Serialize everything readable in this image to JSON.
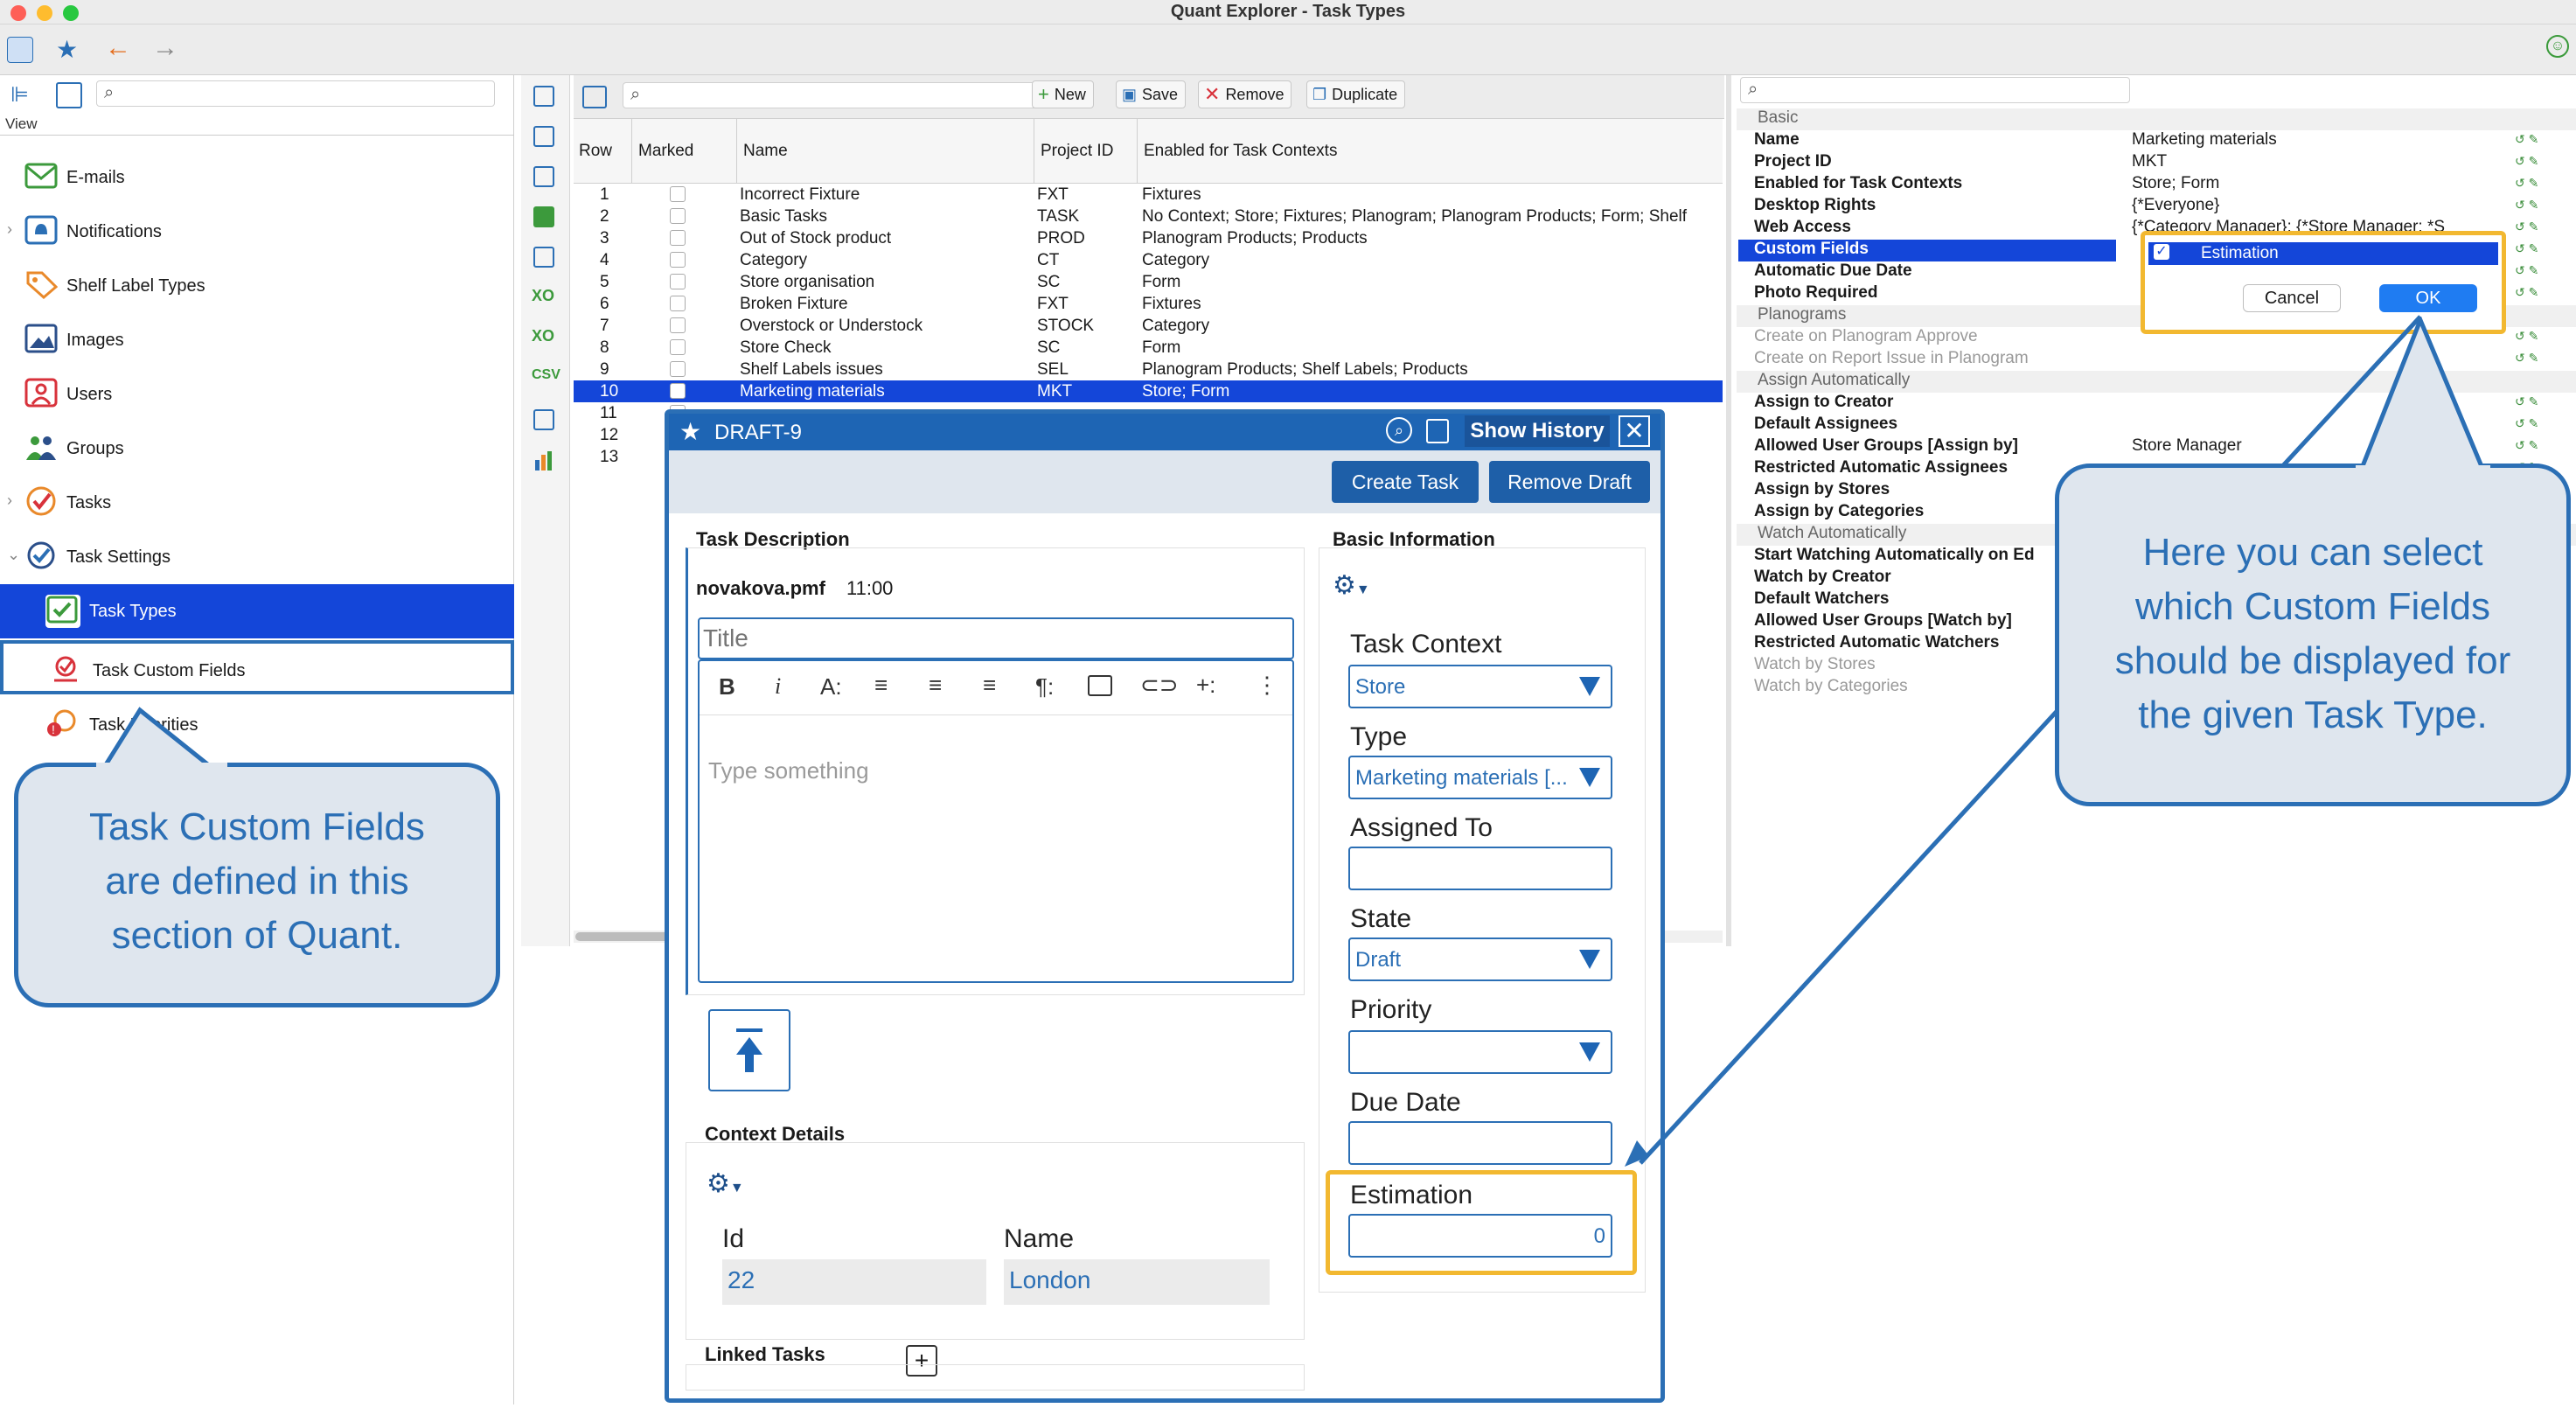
{
  "window": {
    "title": "Quant Explorer - Task Types"
  },
  "left": {
    "view_label": "View",
    "items": [
      {
        "label": "E-mails"
      },
      {
        "label": "Notifications"
      },
      {
        "label": "Shelf Label Types"
      },
      {
        "label": "Images"
      },
      {
        "label": "Users"
      },
      {
        "label": "Groups"
      },
      {
        "label": "Tasks"
      },
      {
        "label": "Task Settings"
      },
      {
        "label": "Task Types"
      },
      {
        "label": "Task Custom Fields"
      },
      {
        "label": "Task Priorities"
      }
    ]
  },
  "mid": {
    "buttons": {
      "new": "New",
      "save": "Save",
      "remove": "Remove",
      "duplicate": "Duplicate"
    },
    "columns": [
      "Row",
      "Marked",
      "Name",
      "Project ID",
      "Enabled for Task Contexts"
    ],
    "rows": [
      {
        "row": "1",
        "name": "Incorrect Fixture",
        "pid": "FXT",
        "ctx": "Fixtures"
      },
      {
        "row": "2",
        "name": "Basic Tasks",
        "pid": "TASK",
        "ctx": "No Context; Store; Fixtures; Planogram; Planogram Products; Form; Shelf"
      },
      {
        "row": "3",
        "name": "Out of Stock product",
        "pid": "PROD",
        "ctx": "Planogram Products; Products"
      },
      {
        "row": "4",
        "name": "Category",
        "pid": "CT",
        "ctx": "Category"
      },
      {
        "row": "5",
        "name": "Store organisation",
        "pid": "SC",
        "ctx": "Form"
      },
      {
        "row": "6",
        "name": "Broken Fixture",
        "pid": "FXT",
        "ctx": "Fixtures"
      },
      {
        "row": "7",
        "name": "Overstock or Understock",
        "pid": "STOCK",
        "ctx": "Category"
      },
      {
        "row": "8",
        "name": "Store Check",
        "pid": "SC",
        "ctx": "Form"
      },
      {
        "row": "9",
        "name": "Shelf Labels issues",
        "pid": "SEL",
        "ctx": "Planogram Products; Shelf Labels; Products"
      },
      {
        "row": "10",
        "name": "Marketing materials",
        "pid": "MKT",
        "ctx": "Store; Form"
      },
      {
        "row": "11",
        "name": "",
        "pid": "",
        "ctx": ""
      },
      {
        "row": "12",
        "name": "",
        "pid": "",
        "ctx": ""
      },
      {
        "row": "13",
        "name": "",
        "pid": "",
        "ctx": ""
      }
    ]
  },
  "props": {
    "group_basic": "Basic",
    "rows": [
      {
        "name": "Name",
        "value": "Marketing materials"
      },
      {
        "name": "Project ID",
        "value": "MKT"
      },
      {
        "name": "Enabled for Task Contexts",
        "value": "Store; Form"
      },
      {
        "name": "Desktop Rights",
        "value": "{*Everyone}"
      },
      {
        "name": "Web Access",
        "value": "{*Category Manager}; {*Store Manager; *S"
      },
      {
        "name": "Custom Fields",
        "value": ""
      },
      {
        "name": "Automatic Due Date",
        "value": ""
      },
      {
        "name": "Photo Required",
        "value": ""
      }
    ],
    "group_planograms": "Planograms",
    "planogram_rows": [
      {
        "name": "Create on Planogram Approve"
      },
      {
        "name": "Create on Report Issue in Planogram"
      }
    ],
    "group_assign": "Assign Automatically",
    "assign_rows": [
      {
        "name": "Assign to Creator",
        "value": ""
      },
      {
        "name": "Default Assignees",
        "value": ""
      },
      {
        "name": "Allowed User Groups [Assign by]",
        "value": "Store Manager"
      },
      {
        "name": "Restricted Automatic Assignees",
        "value": ""
      },
      {
        "name": "Assign by Stores",
        "value": ""
      },
      {
        "name": "Assign by Categories",
        "value": ""
      }
    ],
    "group_watch": "Watch Automatically",
    "watch_rows": [
      {
        "name": "Start Watching Automatically on Ed"
      },
      {
        "name": "Watch by Creator"
      },
      {
        "name": "Default Watchers"
      },
      {
        "name": "Allowed User Groups [Watch by]"
      },
      {
        "name": "Restricted Automatic Watchers"
      },
      {
        "name": "Watch by Stores"
      },
      {
        "name": "Watch by Categories"
      }
    ],
    "custom_popup": {
      "option": "Estimation",
      "cancel": "Cancel",
      "ok": "OK"
    }
  },
  "dialog": {
    "title": "DRAFT-9",
    "show_history": "Show History",
    "create_task": "Create Task",
    "remove_draft": "Remove Draft",
    "task_description": "Task Description",
    "author": "novakova.pmf",
    "time": "11:00",
    "title_placeholder": "Title",
    "body_placeholder": "Type something",
    "context_details": "Context Details",
    "id_label": "Id",
    "id_value": "22",
    "name_label": "Name",
    "name_value": "London",
    "linked_tasks": "Linked Tasks",
    "basic_information": "Basic Information",
    "task_context_label": "Task Context",
    "task_context_value": "Store",
    "type_label": "Type",
    "type_value": "Marketing materials [...",
    "assigned_to_label": "Assigned To",
    "state_label": "State",
    "state_value": "Draft",
    "priority_label": "Priority",
    "due_date_label": "Due Date",
    "estimation_label": "Estimation",
    "estimation_value": "0"
  },
  "callouts": {
    "left": [
      "Task Custom Fields",
      "are defined in this",
      "section of Quant."
    ],
    "right": [
      "Here you can select",
      "which Custom Fields",
      "should be displayed for",
      "the given Task Type."
    ]
  },
  "colors": {
    "accent": "#1e65b4",
    "selection": "#1446d9",
    "highlight": "#f2b830",
    "callout_bg": "#dfe6ee"
  }
}
